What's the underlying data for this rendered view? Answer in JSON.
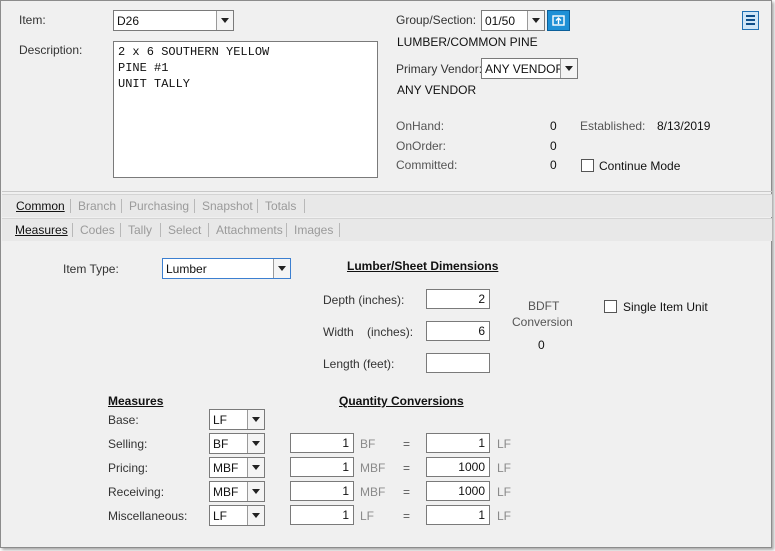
{
  "header": {
    "item_label": "Item:",
    "item_value": "D26",
    "description_label": "Description:",
    "description_lines": [
      "2 x 6 SOUTHERN YELLOW",
      "PINE #1",
      "UNIT TALLY"
    ],
    "group_label": "Group/Section:",
    "group_value": "01/50",
    "group_name": "LUMBER/COMMON PINE",
    "vendor_label": "Primary Vendor:",
    "vendor_value": "ANY VENDOR",
    "vendor_name": "ANY VENDOR",
    "onhand_label": "OnHand:",
    "onhand_value": "0",
    "onorder_label": "OnOrder:",
    "onorder_value": "0",
    "committed_label": "Committed:",
    "committed_value": "0",
    "established_label": "Established:",
    "established_value": "8/13/2019",
    "continue_mode_label": "Continue Mode",
    "continue_mode_checked": false
  },
  "tabs_primary": [
    {
      "label": "Common",
      "active": true
    },
    {
      "label": "Branch",
      "active": false
    },
    {
      "label": "Purchasing",
      "active": false
    },
    {
      "label": "Snapshot",
      "active": false
    },
    {
      "label": "Totals",
      "active": false
    }
  ],
  "tabs_secondary": [
    {
      "label": "Measures",
      "active": true
    },
    {
      "label": "Codes",
      "active": false
    },
    {
      "label": "Tally",
      "active": false
    },
    {
      "label": "Select",
      "active": false
    },
    {
      "label": "Attachments",
      "active": false
    },
    {
      "label": "Images",
      "active": false
    }
  ],
  "measures": {
    "item_type_label": "Item Type:",
    "item_type_value": "Lumber",
    "dimensions_heading": "Lumber/Sheet Dimensions",
    "depth_label": "Depth (inches):",
    "depth_value": "2",
    "width_label": "Width    (inches):",
    "width_value": "6",
    "length_label": "Length (feet):",
    "length_value": "",
    "bdft_label_1": "BDFT",
    "bdft_label_2": "Conversion",
    "bdft_value": "0",
    "single_item_unit_label": "Single Item Unit",
    "single_item_unit_checked": false,
    "measures_heading": "Measures",
    "conversions_heading": "Quantity Conversions",
    "rows": [
      {
        "label": "Base:",
        "measure": "LF"
      },
      {
        "label": "Selling:",
        "measure": "BF",
        "qty": "1",
        "from_unit": "BF",
        "eq": "=",
        "conv": "1",
        "to_unit": "LF"
      },
      {
        "label": "Pricing:",
        "measure": "MBF",
        "qty": "1",
        "from_unit": "MBF",
        "eq": "=",
        "conv": "1000",
        "to_unit": "LF"
      },
      {
        "label": "Receiving:",
        "measure": "MBF",
        "qty": "1",
        "from_unit": "MBF",
        "eq": "=",
        "conv": "1000",
        "to_unit": "LF"
      },
      {
        "label": "Miscellaneous:",
        "measure": "LF",
        "qty": "1",
        "from_unit": "LF",
        "eq": "=",
        "conv": "1",
        "to_unit": "LF"
      }
    ]
  },
  "colors": {
    "accent": "#1e90d6"
  }
}
